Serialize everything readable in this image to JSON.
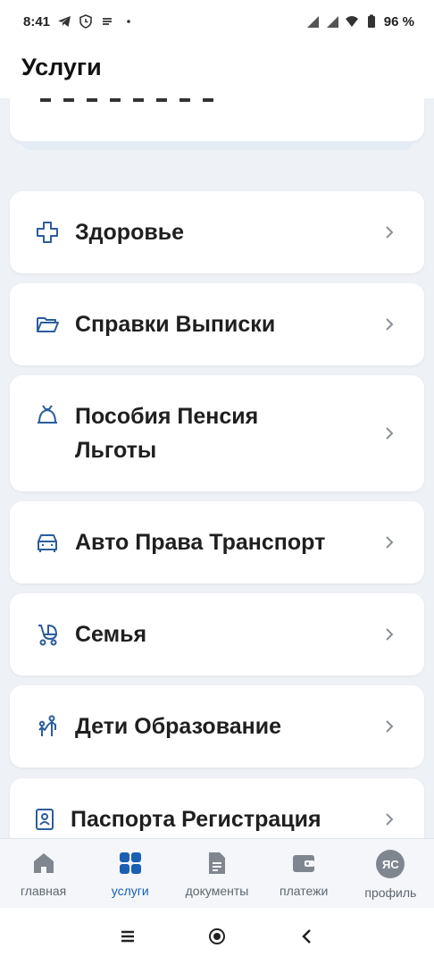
{
  "status_bar": {
    "time": "8:41",
    "battery": "96 %"
  },
  "header": {
    "title": "Услуги"
  },
  "services": [
    {
      "label": "Здоровье",
      "icon": "health-cross-icon"
    },
    {
      "label": "Справки Выписки",
      "icon": "folder-icon"
    },
    {
      "label": "Пособия Пенсия\nЛьготы",
      "icon": "benefits-icon"
    },
    {
      "label": "Авто Права Транспорт",
      "icon": "car-icon"
    },
    {
      "label": "Семья",
      "icon": "stroller-icon"
    },
    {
      "label": "Дети Образование",
      "icon": "children-icon"
    },
    {
      "label": "Паспорта Регистрация",
      "icon": "passport-icon"
    }
  ],
  "bottom_nav": {
    "items": [
      {
        "label": "главная",
        "icon": "home-icon",
        "active": false
      },
      {
        "label": "услуги",
        "icon": "services-grid-icon",
        "active": true
      },
      {
        "label": "документы",
        "icon": "document-icon",
        "active": false
      },
      {
        "label": "платежи",
        "icon": "wallet-icon",
        "active": false
      },
      {
        "label": "профиль",
        "icon": "avatar",
        "active": false
      }
    ],
    "avatar_initials": "ЯС"
  },
  "colors": {
    "accent": "#1a5fb4",
    "icon_blue": "#2b5d9c",
    "inactive": "#80868f",
    "background": "#eef1f6"
  }
}
